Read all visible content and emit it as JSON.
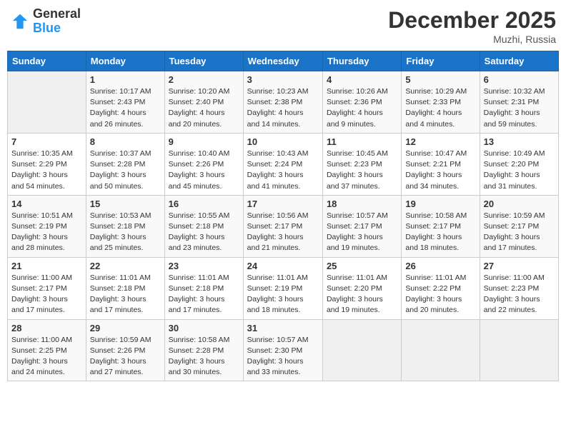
{
  "header": {
    "logo_general": "General",
    "logo_blue": "Blue",
    "month_title": "December 2025",
    "location": "Muzhi, Russia"
  },
  "days_of_week": [
    "Sunday",
    "Monday",
    "Tuesday",
    "Wednesday",
    "Thursday",
    "Friday",
    "Saturday"
  ],
  "weeks": [
    [
      {
        "day": "",
        "info": ""
      },
      {
        "day": "1",
        "info": "Sunrise: 10:17 AM\nSunset: 2:43 PM\nDaylight: 4 hours\nand 26 minutes."
      },
      {
        "day": "2",
        "info": "Sunrise: 10:20 AM\nSunset: 2:40 PM\nDaylight: 4 hours\nand 20 minutes."
      },
      {
        "day": "3",
        "info": "Sunrise: 10:23 AM\nSunset: 2:38 PM\nDaylight: 4 hours\nand 14 minutes."
      },
      {
        "day": "4",
        "info": "Sunrise: 10:26 AM\nSunset: 2:36 PM\nDaylight: 4 hours\nand 9 minutes."
      },
      {
        "day": "5",
        "info": "Sunrise: 10:29 AM\nSunset: 2:33 PM\nDaylight: 4 hours\nand 4 minutes."
      },
      {
        "day": "6",
        "info": "Sunrise: 10:32 AM\nSunset: 2:31 PM\nDaylight: 3 hours\nand 59 minutes."
      }
    ],
    [
      {
        "day": "7",
        "info": "Sunrise: 10:35 AM\nSunset: 2:29 PM\nDaylight: 3 hours\nand 54 minutes."
      },
      {
        "day": "8",
        "info": "Sunrise: 10:37 AM\nSunset: 2:28 PM\nDaylight: 3 hours\nand 50 minutes."
      },
      {
        "day": "9",
        "info": "Sunrise: 10:40 AM\nSunset: 2:26 PM\nDaylight: 3 hours\nand 45 minutes."
      },
      {
        "day": "10",
        "info": "Sunrise: 10:43 AM\nSunset: 2:24 PM\nDaylight: 3 hours\nand 41 minutes."
      },
      {
        "day": "11",
        "info": "Sunrise: 10:45 AM\nSunset: 2:23 PM\nDaylight: 3 hours\nand 37 minutes."
      },
      {
        "day": "12",
        "info": "Sunrise: 10:47 AM\nSunset: 2:21 PM\nDaylight: 3 hours\nand 34 minutes."
      },
      {
        "day": "13",
        "info": "Sunrise: 10:49 AM\nSunset: 2:20 PM\nDaylight: 3 hours\nand 31 minutes."
      }
    ],
    [
      {
        "day": "14",
        "info": "Sunrise: 10:51 AM\nSunset: 2:19 PM\nDaylight: 3 hours\nand 28 minutes."
      },
      {
        "day": "15",
        "info": "Sunrise: 10:53 AM\nSunset: 2:18 PM\nDaylight: 3 hours\nand 25 minutes."
      },
      {
        "day": "16",
        "info": "Sunrise: 10:55 AM\nSunset: 2:18 PM\nDaylight: 3 hours\nand 23 minutes."
      },
      {
        "day": "17",
        "info": "Sunrise: 10:56 AM\nSunset: 2:17 PM\nDaylight: 3 hours\nand 21 minutes."
      },
      {
        "day": "18",
        "info": "Sunrise: 10:57 AM\nSunset: 2:17 PM\nDaylight: 3 hours\nand 19 minutes."
      },
      {
        "day": "19",
        "info": "Sunrise: 10:58 AM\nSunset: 2:17 PM\nDaylight: 3 hours\nand 18 minutes."
      },
      {
        "day": "20",
        "info": "Sunrise: 10:59 AM\nSunset: 2:17 PM\nDaylight: 3 hours\nand 17 minutes."
      }
    ],
    [
      {
        "day": "21",
        "info": "Sunrise: 11:00 AM\nSunset: 2:17 PM\nDaylight: 3 hours\nand 17 minutes."
      },
      {
        "day": "22",
        "info": "Sunrise: 11:01 AM\nSunset: 2:18 PM\nDaylight: 3 hours\nand 17 minutes."
      },
      {
        "day": "23",
        "info": "Sunrise: 11:01 AM\nSunset: 2:18 PM\nDaylight: 3 hours\nand 17 minutes."
      },
      {
        "day": "24",
        "info": "Sunrise: 11:01 AM\nSunset: 2:19 PM\nDaylight: 3 hours\nand 18 minutes."
      },
      {
        "day": "25",
        "info": "Sunrise: 11:01 AM\nSunset: 2:20 PM\nDaylight: 3 hours\nand 19 minutes."
      },
      {
        "day": "26",
        "info": "Sunrise: 11:01 AM\nSunset: 2:22 PM\nDaylight: 3 hours\nand 20 minutes."
      },
      {
        "day": "27",
        "info": "Sunrise: 11:00 AM\nSunset: 2:23 PM\nDaylight: 3 hours\nand 22 minutes."
      }
    ],
    [
      {
        "day": "28",
        "info": "Sunrise: 11:00 AM\nSunset: 2:25 PM\nDaylight: 3 hours\nand 24 minutes."
      },
      {
        "day": "29",
        "info": "Sunrise: 10:59 AM\nSunset: 2:26 PM\nDaylight: 3 hours\nand 27 minutes."
      },
      {
        "day": "30",
        "info": "Sunrise: 10:58 AM\nSunset: 2:28 PM\nDaylight: 3 hours\nand 30 minutes."
      },
      {
        "day": "31",
        "info": "Sunrise: 10:57 AM\nSunset: 2:30 PM\nDaylight: 3 hours\nand 33 minutes."
      },
      {
        "day": "",
        "info": ""
      },
      {
        "day": "",
        "info": ""
      },
      {
        "day": "",
        "info": ""
      }
    ]
  ]
}
